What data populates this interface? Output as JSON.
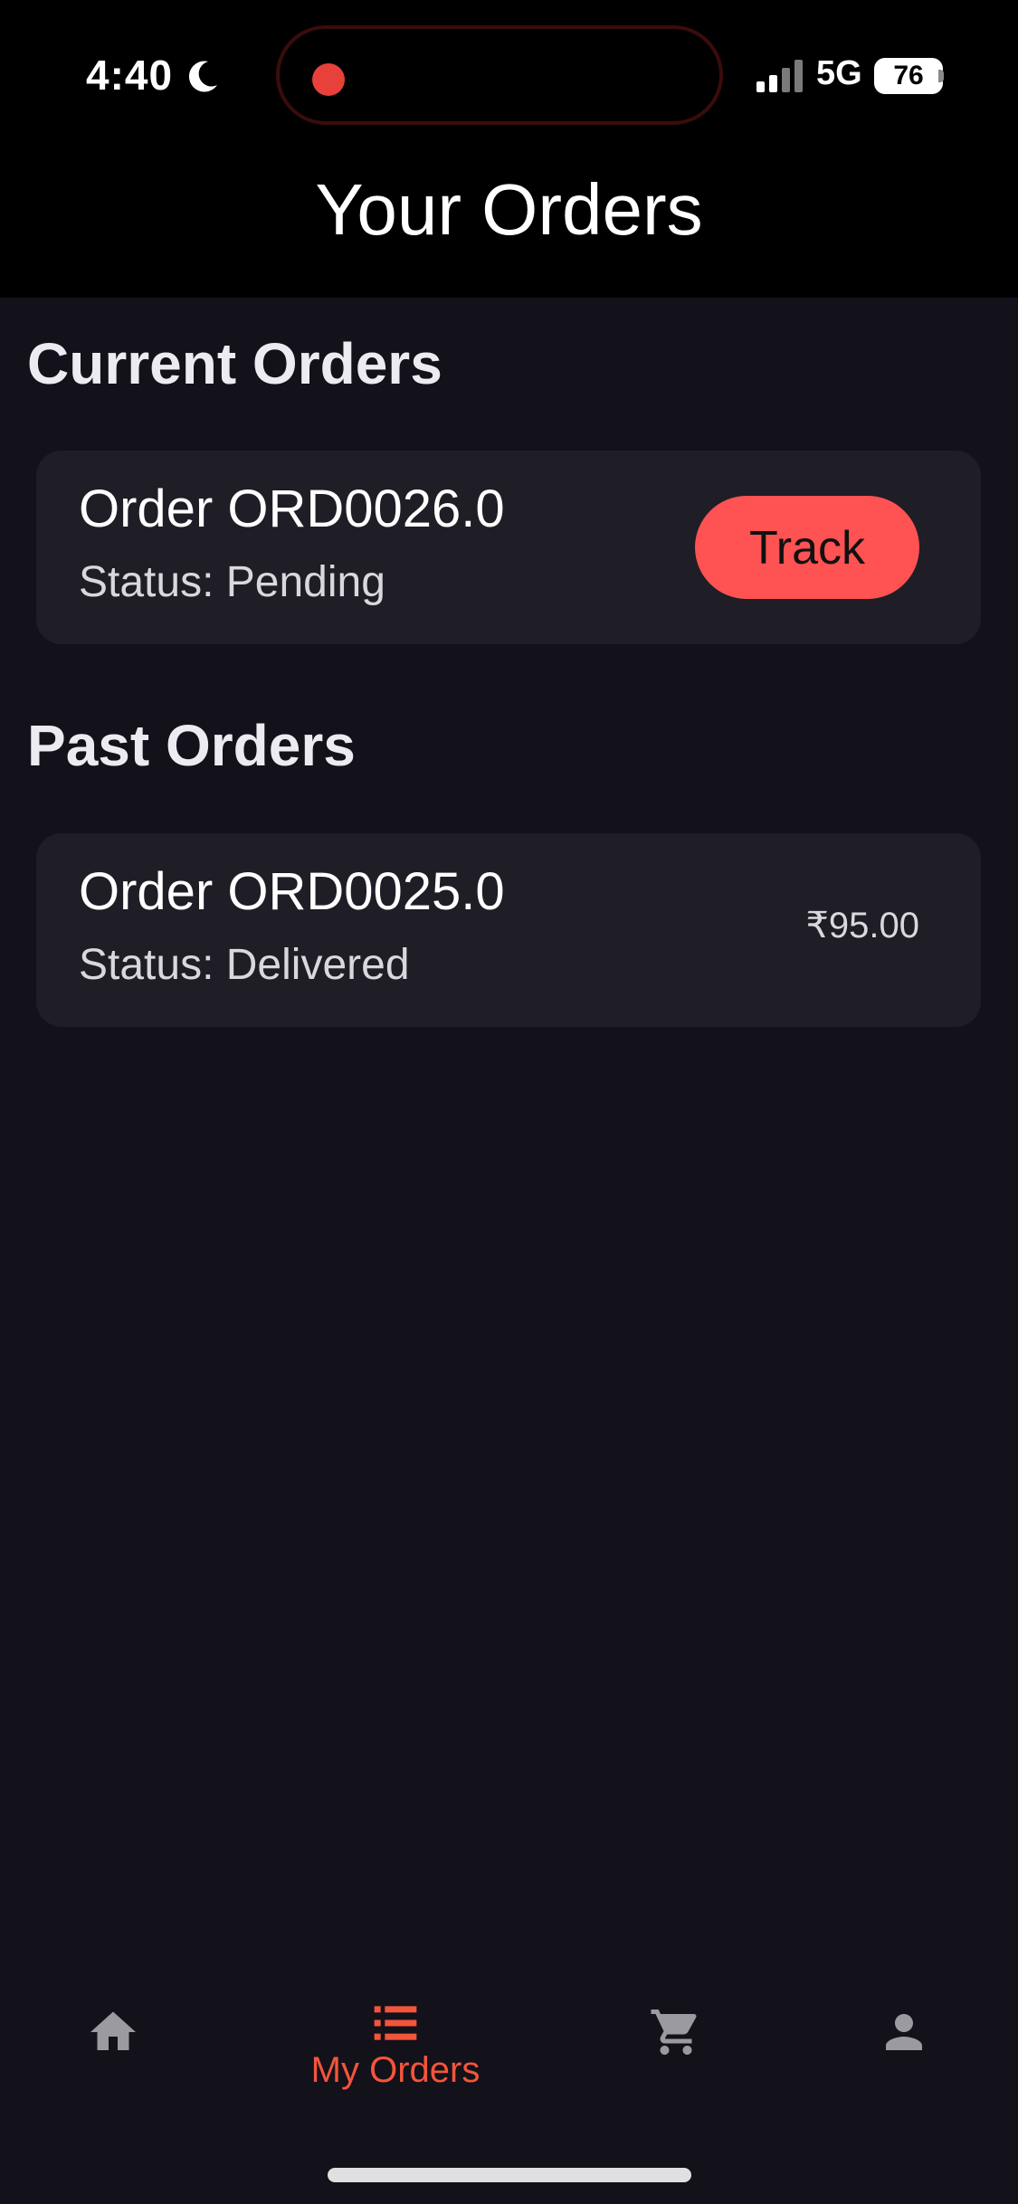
{
  "status_bar": {
    "time": "4:40",
    "network": "5G",
    "battery": "76",
    "moon_icon": "moon-icon",
    "signal_icon": "cellular-signal-icon",
    "recording_color": "#e8403a"
  },
  "header": {
    "title": "Your Orders"
  },
  "current_orders": {
    "title": "Current Orders",
    "orders": [
      {
        "order_label": "Order ORD0026.0",
        "status": "Status: Pending",
        "track_label": "Track"
      }
    ]
  },
  "past_orders": {
    "title": "Past Orders",
    "orders": [
      {
        "order_label": "Order ORD0025.0",
        "status": "Status: Delivered",
        "price": "₹95.00"
      }
    ]
  },
  "bottom_nav": {
    "items": [
      {
        "icon": "home-icon",
        "label": "",
        "active": false
      },
      {
        "icon": "list-icon",
        "label": "My Orders",
        "active": true
      },
      {
        "icon": "cart-icon",
        "label": "",
        "active": false
      },
      {
        "icon": "person-icon",
        "label": "",
        "active": false
      }
    ],
    "active_color": "#f2553c",
    "inactive_color": "#9a9aa0"
  },
  "colors": {
    "background": "#13111a",
    "card": "#1f1d26",
    "accent": "#ff5252"
  }
}
